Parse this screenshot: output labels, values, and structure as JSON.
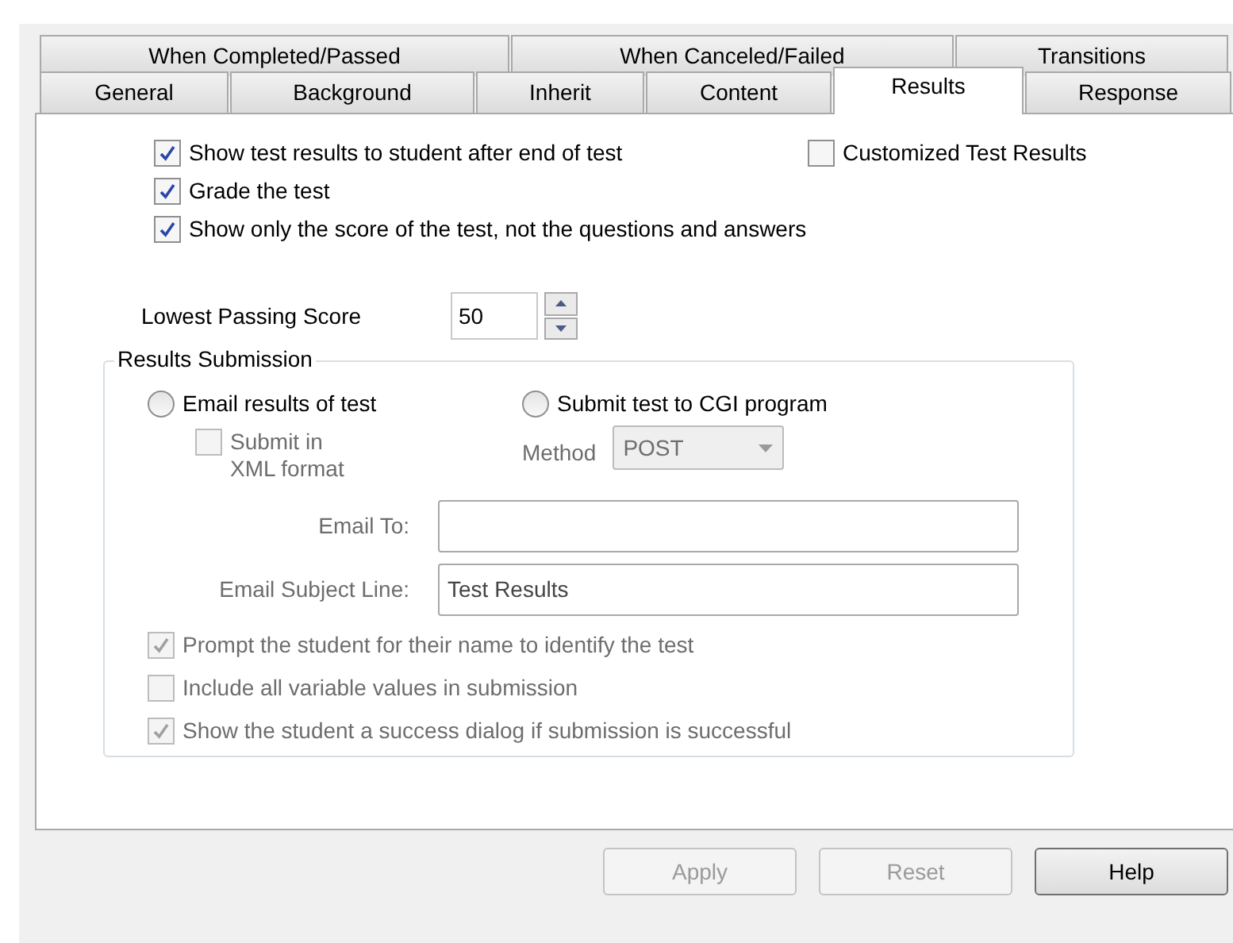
{
  "tabs_row_1": [
    {
      "label": "When Completed/Passed",
      "selected": false
    },
    {
      "label": "When Canceled/Failed",
      "selected": false
    },
    {
      "label": "Transitions",
      "selected": false
    }
  ],
  "tabs_row_2": [
    {
      "label": "General",
      "selected": false
    },
    {
      "label": "Background",
      "selected": false
    },
    {
      "label": "Inherit",
      "selected": false
    },
    {
      "label": "Content",
      "selected": false
    },
    {
      "label": "Results",
      "selected": true
    },
    {
      "label": "Response",
      "selected": false
    }
  ],
  "options": [
    {
      "label": "Show test results to student after end of test",
      "checked": true,
      "disabled": false
    },
    {
      "label": "Grade the test",
      "checked": true,
      "disabled": false
    },
    {
      "label": "Show only the score of the test, not the questions and answers",
      "checked": true,
      "disabled": false
    }
  ],
  "customized": {
    "label": "Customized Test Results",
    "checked": false,
    "disabled": false
  },
  "lowest_passing_score": {
    "label": "Lowest Passing Score",
    "value": "50"
  },
  "results_submission": {
    "title": "Results Submission",
    "delivery": [
      {
        "label": "Email results of test",
        "selected": false
      },
      {
        "label": "Submit test to CGI program",
        "selected": false
      }
    ],
    "xml_format": {
      "label": "Submit in XML format",
      "checked": false,
      "disabled": true
    },
    "method": {
      "label": "Method",
      "value": "POST"
    },
    "email_to": {
      "label": "Email To:"
    },
    "subject": {
      "label": "Email Subject Line:",
      "value": "Test Results"
    },
    "options": [
      {
        "label": "Prompt the student for their name to identify the test",
        "checked": true,
        "disabled": true
      },
      {
        "label": "Include all variable values in submission",
        "checked": false,
        "disabled": true
      },
      {
        "label": "Show the student a success dialog if submission is successful",
        "checked": true,
        "disabled": true
      }
    ]
  },
  "buttons": [
    {
      "label": "Apply",
      "disabled": true
    },
    {
      "label": "Reset",
      "disabled": true
    },
    {
      "label": "Help",
      "disabled": false
    }
  ]
}
